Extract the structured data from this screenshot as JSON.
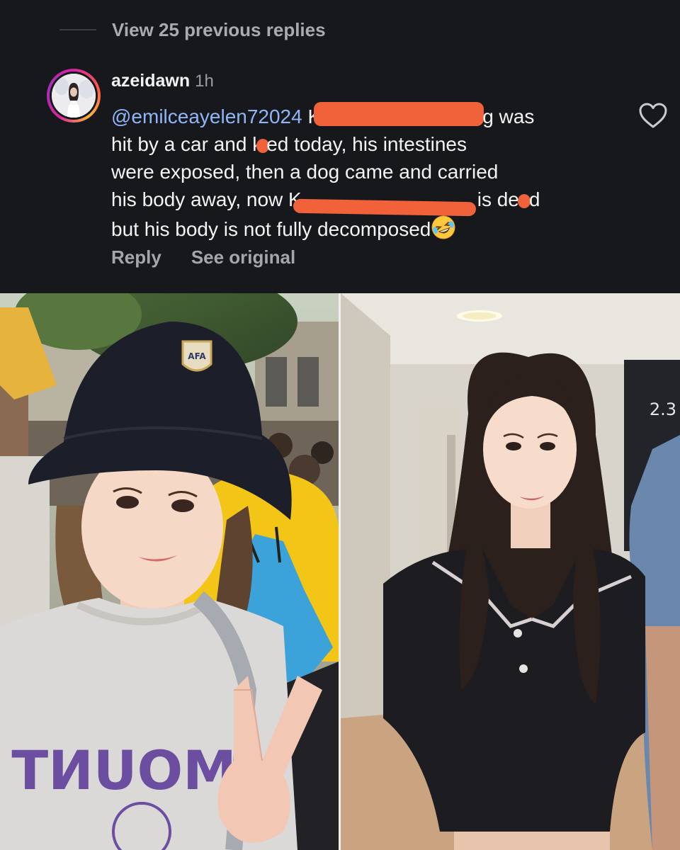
{
  "thread": {
    "view_previous_label": "View 25 previous replies"
  },
  "comment": {
    "username": "azeidawn",
    "time": "1h",
    "mention": "@emilceayelen72024",
    "line1_prefix": "K",
    "line1_suffix": "g was",
    "line2_a": "hit by a car and k",
    "line2_b": "ed today, his intestines",
    "line3": "were exposed, then a dog came and carried",
    "line4_a": "his body away, now K",
    "line4_b": "is de",
    "line4_c": "d",
    "line5": "but his body is not fully decomposed",
    "emoji": "rolling-on-floor-laughing-emoji",
    "redaction_color": "#f1613a",
    "actions": {
      "reply": "Reply",
      "see_original": "See original"
    }
  },
  "photos": {
    "left": {
      "hat_badge": "AFA",
      "shirt_text": "MOUNT"
    },
    "right": {
      "sign_text": "2.3"
    }
  },
  "colors": {
    "background": "#16181c",
    "mention": "#8fb6f7",
    "text": "#f4f4f4",
    "muted": "#a3a6ab"
  }
}
